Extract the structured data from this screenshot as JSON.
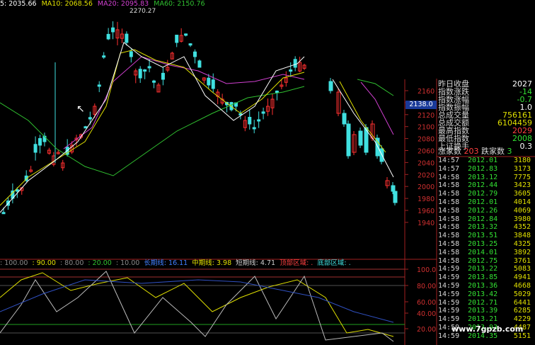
{
  "legend": {
    "ma5": "5: 2035.66",
    "ma10": "MA10: 2068.56",
    "ma20": "MA20: 2095.83",
    "ma60": "MA60: 2150.76"
  },
  "high_label": "2270.27",
  "price_axis": {
    "labels": [
      "2160",
      "2140",
      "2120",
      "2100",
      "2080",
      "2060",
      "2040",
      "2020",
      "2000",
      "1980",
      "1960",
      "1940"
    ],
    "current": "2138.0"
  },
  "indicator_legend": {
    "l100": ": 100.00",
    "l90": ": 90.00",
    "l80": ": 80.00",
    "l20": ": 20.00",
    "l10": ": 10.00",
    "long": "长期线: 16.11",
    "mid": "中期线: 3.98",
    "short": "短期线: 4.71",
    "top": "顶部区域: .",
    "bottom": "底部区域: ."
  },
  "indicator_axis": [
    "100.0",
    "80.00",
    "60.00",
    "40.00",
    "20.00"
  ],
  "stats": [
    {
      "k": "昨日收盘",
      "v": "2027",
      "c": "#ffffff"
    },
    {
      "k": "指数涨跌",
      "v": "-14",
      "c": "#33e033"
    },
    {
      "k": "指数涨幅",
      "v": "-0.7",
      "c": "#33e033"
    },
    {
      "k": "指数振幅",
      "v": "1.0",
      "c": "#ffffff"
    },
    {
      "k": "总成交量",
      "v": "756161",
      "c": "#e0e000"
    },
    {
      "k": "总成交额",
      "v": "6104459",
      "c": "#e0e000"
    },
    {
      "k": "最高指数",
      "v": "2029",
      "c": "#ff4040"
    },
    {
      "k": "最低指数",
      "v": "2008",
      "c": "#33e033"
    },
    {
      "k": "上证换手",
      "v": "0.3",
      "c": "#ffffff"
    }
  ],
  "updown": {
    "up_label": "涨家数",
    "up": "203",
    "down_label": "跌家数",
    "down": "3"
  },
  "ticks": [
    [
      "14:57",
      "2012.01",
      "3180"
    ],
    [
      "14:57",
      "2012.83",
      "3173"
    ],
    [
      "14:58",
      "2013.12",
      "7775"
    ],
    [
      "14:58",
      "2012.44",
      "3423"
    ],
    [
      "14:58",
      "2012.79",
      "3605"
    ],
    [
      "14:58",
      "2012.01",
      "4014"
    ],
    [
      "14:58",
      "2012.26",
      "4069"
    ],
    [
      "14:58",
      "2012.84",
      "3980"
    ],
    [
      "14:58",
      "2013.32",
      "4352"
    ],
    [
      "14:58",
      "2013.51",
      "3848"
    ],
    [
      "14:58",
      "2013.25",
      "4325"
    ],
    [
      "14:58",
      "2014.01",
      "3892"
    ],
    [
      "14:58",
      "2012.75",
      "3761"
    ],
    [
      "14:59",
      "2013.22",
      "5083"
    ],
    [
      "14:59",
      "2013.85",
      "4941"
    ],
    [
      "14:59",
      "2013.36",
      "4668"
    ],
    [
      "14:59",
      "2013.42",
      "5029"
    ],
    [
      "14:59",
      "2012.71",
      "6441"
    ],
    [
      "14:59",
      "2013.39",
      "6285"
    ],
    [
      "14:59",
      "2013.21",
      "4229"
    ],
    [
      "14:59",
      "2013.93",
      "4487"
    ],
    [
      "14:59",
      "2014.35",
      "5151"
    ]
  ],
  "watermark": "www.7gpzb.com",
  "colors": {
    "up": "#ff3030",
    "down": "#40e0e0",
    "ma5": "#ffffff",
    "ma10": "#e0e000",
    "ma20": "#d040d0",
    "ma60": "#30c030"
  }
}
